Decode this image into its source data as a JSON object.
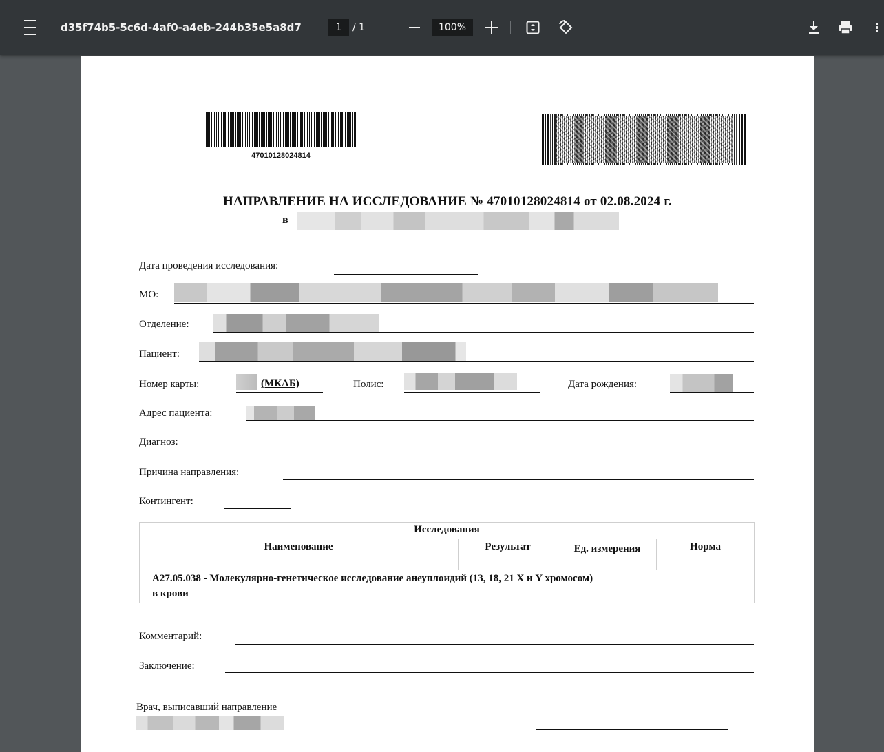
{
  "toolbar": {
    "title": "d35f74b5-5c6d-4af0-a4eb-244b35e5a8d7",
    "page_current": "1",
    "page_separator": "/ 1",
    "zoom": "100%"
  },
  "document": {
    "barcode_number": "47010128024814",
    "title": "НАПРАВЛЕНИЕ НА ИССЛЕДОВАНИЕ № 47010128024814 от 02.08.2024 г.",
    "title_prefix_v": "в",
    "fields": {
      "date_label": "Дата проведения исследования:",
      "mo_label": "МО:",
      "department_label": "Отделение:",
      "patient_label": "Пациент:",
      "card_label": "Номер карты:",
      "card_suffix": "(МКАБ)",
      "policy_label": "Полис:",
      "birth_label": "Дата рождения:",
      "address_label": "Адрес пациента:",
      "diagnosis_label": "Диагноз:",
      "reason_label": "Причина направления:",
      "contingent_label": "Контингент:"
    },
    "table": {
      "caption": "Исследования",
      "headers": [
        "Наименование",
        "Результат",
        "Ед. измерения",
        "Норма"
      ],
      "row_line1": "A27.05.038 - Молекулярно-генетическое исследование анеуплоидий (13, 18, 21 X и Y хромосом)",
      "row_line2": "в крови"
    },
    "comment_label": "Комментарий:",
    "conclusion_label": "Заключение:",
    "doctor_label": "Врач, выписавший направление"
  }
}
